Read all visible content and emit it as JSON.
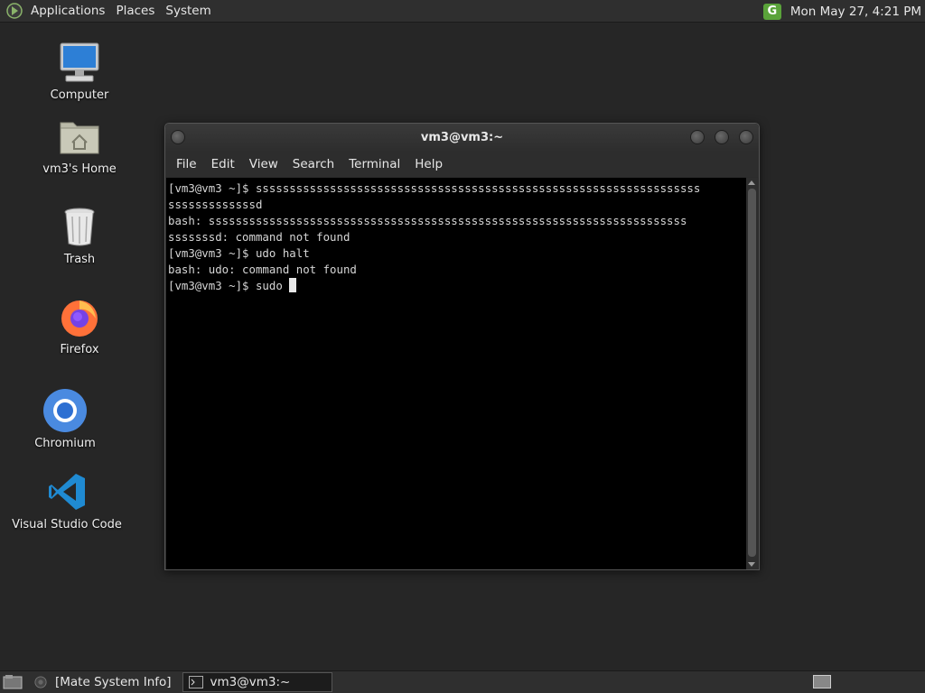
{
  "top_panel": {
    "menus": [
      "Applications",
      "Places",
      "System"
    ],
    "clock": "Mon May 27,  4:21 PM",
    "tray_icon_letter": "G"
  },
  "desktop": {
    "icons": [
      {
        "label": "Computer",
        "icon": "computer-icon"
      },
      {
        "label": "vm3's Home",
        "icon": "home-folder-icon"
      },
      {
        "label": "Trash",
        "icon": "trash-icon"
      },
      {
        "label": "Firefox",
        "icon": "firefox-icon"
      },
      {
        "label": "Chromium",
        "icon": "chromium-icon"
      },
      {
        "label": "Visual Studio Code",
        "icon": "vscode-icon"
      }
    ]
  },
  "terminal": {
    "title": "vm3@vm3:~",
    "menu": [
      "File",
      "Edit",
      "View",
      "Search",
      "Terminal",
      "Help"
    ],
    "lines": [
      "[vm3@vm3 ~]$ ssssssssssssssssssssssssssssssssssssssssssssssssssssssssssssssssss",
      "sssssssssssssd",
      "bash: sssssssssssssssssssssssssssssssssssssssssssssssssssssssssssssssssssssss",
      "sssssssd: command not found",
      "[vm3@vm3 ~]$ udo halt",
      "bash: udo: command not found"
    ],
    "prompt_line": "[vm3@vm3 ~]$ sudo "
  },
  "bottom_panel": {
    "tasks": [
      {
        "label": "[Mate System Info]",
        "active": false
      },
      {
        "label": "vm3@vm3:~",
        "active": true
      }
    ]
  },
  "colors": {
    "desktop_bg": "#262626",
    "panel_bg": "#2f2f2f",
    "terminal_bg": "#000000",
    "terminal_fg": "#d6d6d6",
    "tray_green": "#5aa33a"
  }
}
